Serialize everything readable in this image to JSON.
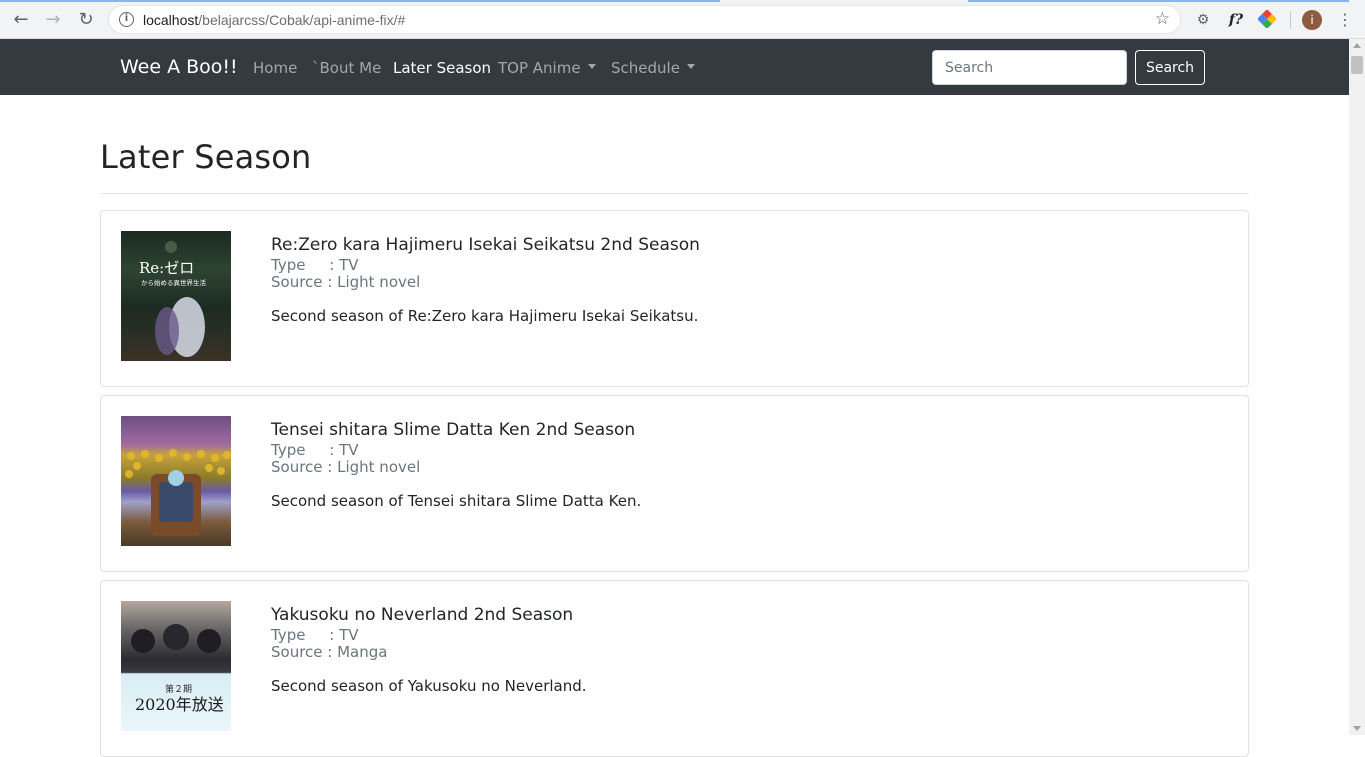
{
  "browser": {
    "url_host": "localhost",
    "url_path": "/belajarcss/Cobak/api-anime-fix/#",
    "avatar_letter": "i",
    "ext_font_label": "f?"
  },
  "navbar": {
    "brand": "Wee A Boo!!",
    "links": [
      {
        "label": "Home"
      },
      {
        "label": "`Bout Me"
      },
      {
        "label": "Later Season"
      },
      {
        "label": "TOP Anime"
      },
      {
        "label": "Schedule"
      }
    ],
    "search_placeholder": "Search",
    "search_button": "Search"
  },
  "page": {
    "title": "Later Season",
    "type_label": "Type     : ",
    "source_label": "Source : "
  },
  "animes": [
    {
      "title": "Re:Zero kara Hajimeru Isekai Seikatsu 2nd Season",
      "type": "TV",
      "source": "Light novel",
      "synopsis": "Second season of Re:Zero kara Hajimeru Isekai Seikatsu.",
      "poster_text_main": "Re:ゼロ",
      "poster_text_sub": "から始める異世界生活"
    },
    {
      "title": "Tensei shitara Slime Datta Ken 2nd Season",
      "type": "TV",
      "source": "Light novel",
      "synopsis": "Second season of Tensei shitara Slime Datta Ken."
    },
    {
      "title": "Yakusoku no Neverland 2nd Season",
      "type": "TV",
      "source": "Manga",
      "synopsis": "Second season of Yakusoku no Neverland.",
      "poster_text_top": "第２期",
      "poster_text_bottom": "2020年放送"
    }
  ],
  "colors": {
    "navbar_bg": "#343a40",
    "muted": "#6c757d",
    "text": "#212529"
  }
}
